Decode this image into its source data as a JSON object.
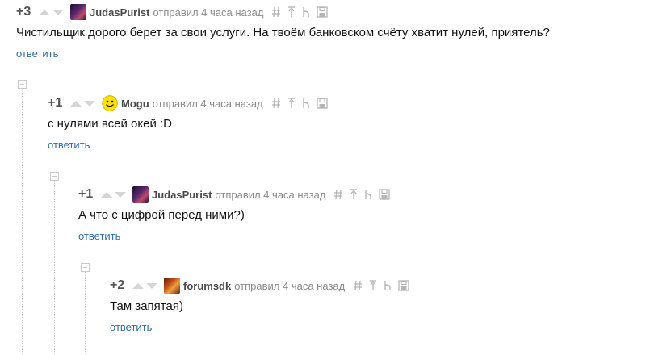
{
  "comments": [
    {
      "score": "+3",
      "author": "JudasPurist",
      "meta": "отправил 4 часа назад",
      "body": "Чистильщик дорого берет за свои услуги. На твоём банковском счёту хватит нулей, приятель?",
      "reply": "ответить",
      "avatar": "avatar-judaspurist"
    },
    {
      "score": "+1",
      "author": "Mogu",
      "meta": "отправил 4 часа назад",
      "body": "с нулями всей окей :D",
      "reply": "ответить",
      "avatar": "avatar-mogu-smiley"
    },
    {
      "score": "+1",
      "author": "JudasPurist",
      "meta": "отправил 4 часа назад",
      "body": "А что с цифрой перед ними?)",
      "reply": "ответить",
      "avatar": "avatar-judaspurist"
    },
    {
      "score": "+2",
      "author": "forumsdk",
      "meta": "отправил 4 часа назад",
      "body": "Там запятая)",
      "reply": "ответить",
      "avatar": "avatar-forumsdk"
    }
  ],
  "icons": [
    "hash-icon",
    "arrow-up-icon",
    "reply-branch-icon",
    "save-icon",
    "vote-up-icon",
    "vote-down-icon",
    "collapse-icon"
  ],
  "colors": {
    "link": "#2f6ea5",
    "muted": "#8a8a8a",
    "vote": "#d5d5d5"
  }
}
